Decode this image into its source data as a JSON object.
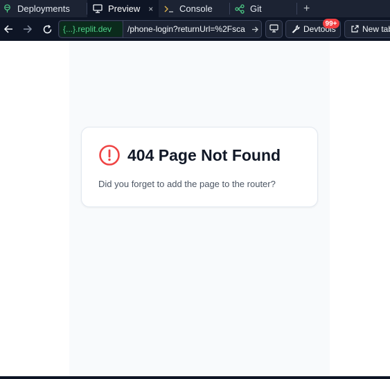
{
  "tabs": [
    {
      "label": "Deployments",
      "icon": "deployments-icon",
      "active": false
    },
    {
      "label": "Preview",
      "icon": "monitor-icon",
      "active": true
    },
    {
      "label": "Console",
      "icon": "terminal-icon",
      "active": false
    },
    {
      "label": "Git",
      "icon": "git-branch-icon",
      "active": false
    }
  ],
  "tab_close_symbol": "×",
  "new_tab_symbol": "+",
  "toolbar": {
    "url_domain": "{...}.replit.dev",
    "url_path": "/phone-login?returnUrl=%2Fsca",
    "devtools_label": "Devtools",
    "devtools_badge": "99+",
    "new_tab_label": "New tab"
  },
  "page": {
    "title": "404 Page Not Found",
    "message": "Did you forget to add the page to the router?"
  },
  "colors": {
    "chrome_dark": "#0e1525",
    "tabbar": "#1c2333",
    "domain_green": "#4fd38a",
    "badge_red": "#f23f42",
    "error_red": "#ef4444"
  }
}
